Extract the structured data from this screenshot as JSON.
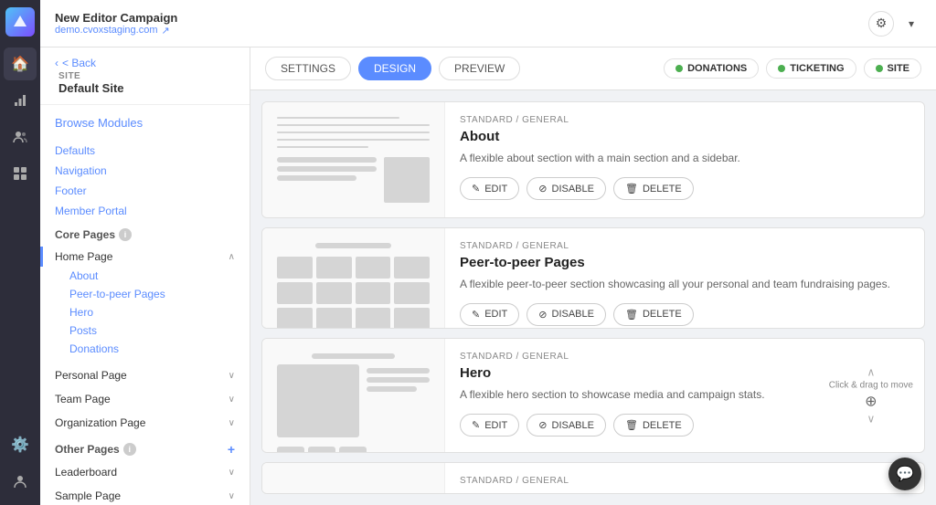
{
  "topBar": {
    "campaignTitle": "New Editor Campaign",
    "campaignUrl": "demo.cvoxstaging.com",
    "externalIcon": "↗"
  },
  "sidebar": {
    "backLabel": "< Back",
    "siteLabel": "SITE",
    "siteName": "Default Site",
    "browseModules": "Browse Modules",
    "links": [
      {
        "label": "Defaults"
      },
      {
        "label": "Navigation"
      },
      {
        "label": "Footer"
      },
      {
        "label": "Member Portal"
      }
    ],
    "corePagesTitle": "Core Pages",
    "pages": [
      {
        "label": "Home Page",
        "expanded": true,
        "subItems": [
          "About",
          "Peer-to-peer Pages",
          "Hero",
          "Posts",
          "Donations"
        ]
      },
      {
        "label": "Personal Page",
        "expanded": false
      },
      {
        "label": "Team Page",
        "expanded": false
      },
      {
        "label": "Organization Page",
        "expanded": false
      }
    ],
    "otherPagesTitle": "Other Pages",
    "otherPages": [
      {
        "label": "Leaderboard",
        "expanded": false
      },
      {
        "label": "Sample Page",
        "expanded": false
      }
    ]
  },
  "tabs": {
    "settings": "SETTINGS",
    "design": "DESIGN",
    "preview": "PREVIEW"
  },
  "statusPills": [
    {
      "label": "DONATIONS",
      "color": "green"
    },
    {
      "label": "TICKETING",
      "color": "green"
    },
    {
      "label": "SITE",
      "color": "green"
    }
  ],
  "modules": [
    {
      "breadcrumb": "STANDARD / GENERAL",
      "title": "About",
      "description": "A flexible about section with a main section and a sidebar.",
      "actions": [
        "EDIT",
        "DISABLE",
        "DELETE"
      ],
      "type": "text-preview"
    },
    {
      "breadcrumb": "STANDARD / GENERAL",
      "title": "Peer-to-peer Pages",
      "description": "A flexible peer-to-peer section showcasing all your personal and team fundraising pages.",
      "actions": [
        "EDIT",
        "DISABLE",
        "DELETE"
      ],
      "type": "grid-preview"
    },
    {
      "breadcrumb": "STANDARD / GENERAL",
      "title": "Hero",
      "description": "A flexible hero section to showcase media and campaign stats.",
      "actions": [
        "EDIT",
        "DISABLE",
        "DELETE"
      ],
      "type": "hero-preview",
      "hasDrag": true
    },
    {
      "breadcrumb": "STANDARD / GENERAL",
      "title": "",
      "description": "",
      "actions": [],
      "type": "partial"
    }
  ],
  "dragLabel": "Click & drag to move",
  "actionLabels": {
    "edit": "EDIT",
    "disable": "DISABLE",
    "delete": "DELETE"
  },
  "iconNav": [
    {
      "icon": "🏠",
      "name": "home"
    },
    {
      "icon": "⚡",
      "name": "activity"
    },
    {
      "icon": "👥",
      "name": "users"
    },
    {
      "icon": "📊",
      "name": "stats"
    },
    {
      "icon": "⚙️",
      "name": "settings"
    }
  ]
}
